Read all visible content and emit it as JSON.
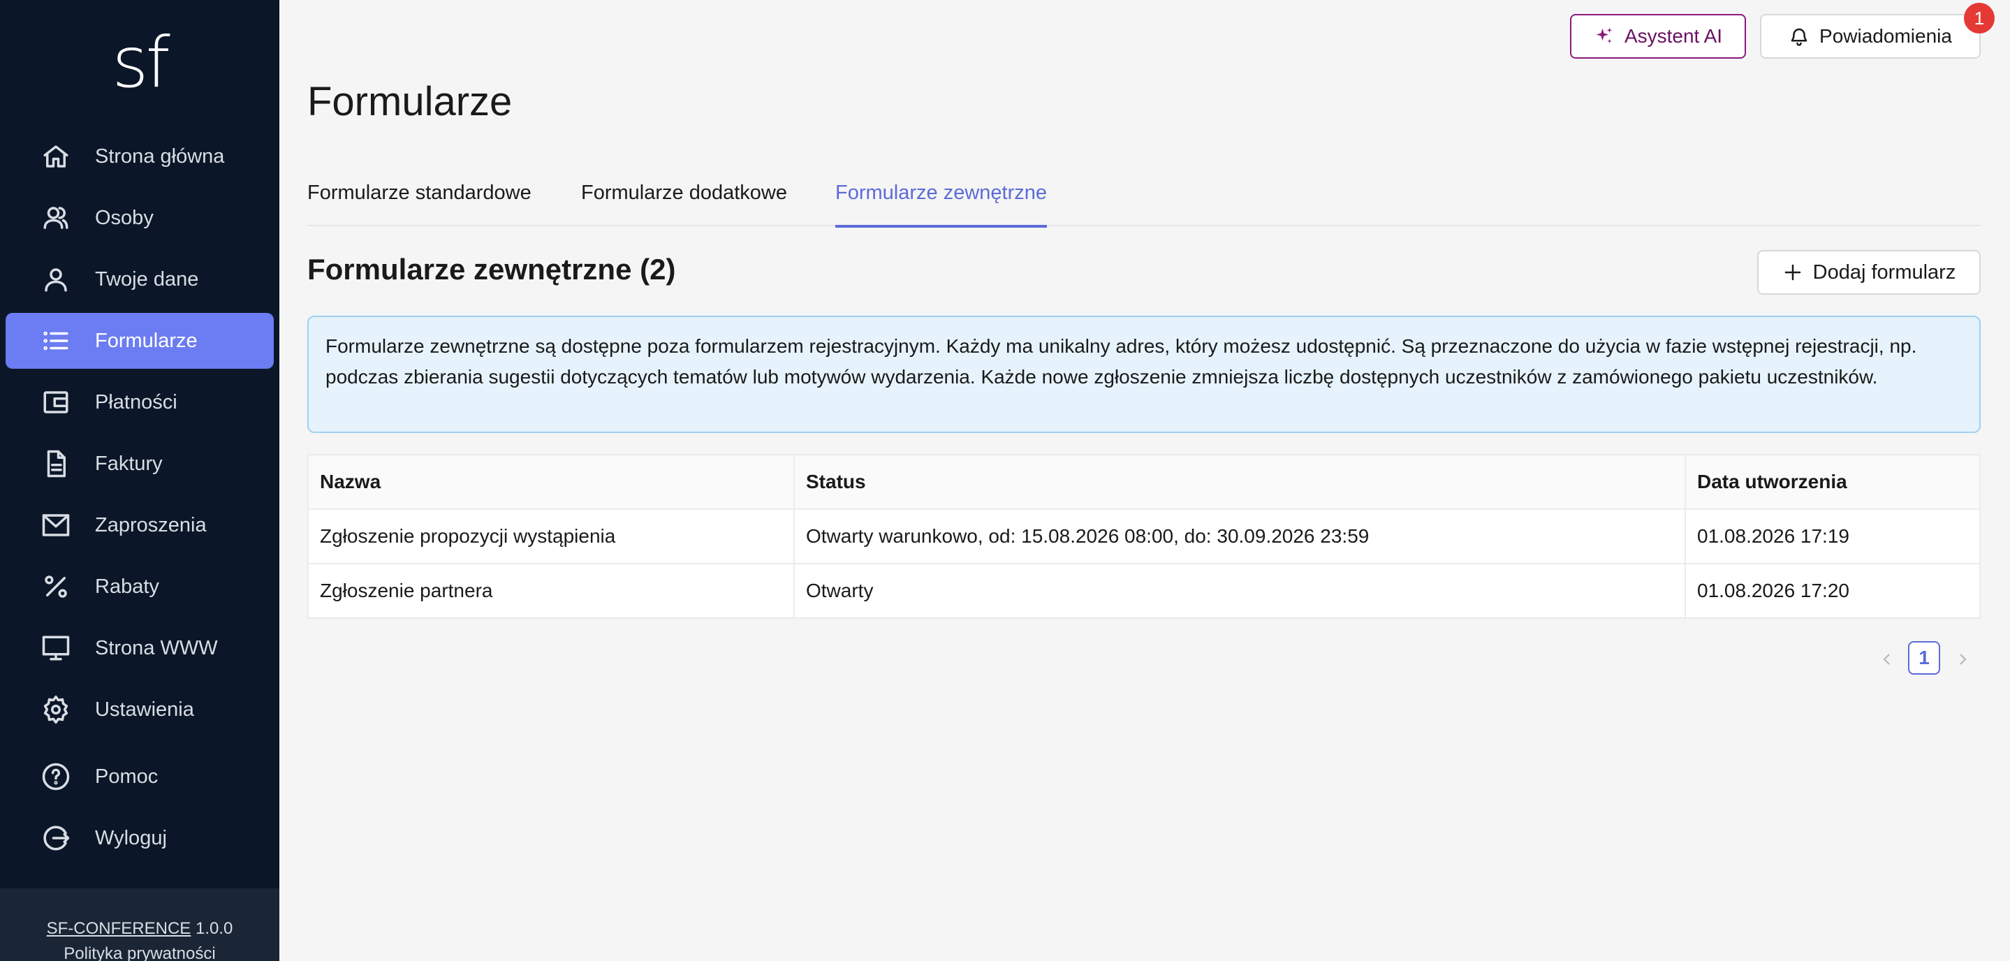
{
  "sidebar": {
    "logo": "sf",
    "items": [
      {
        "label": "Strona główna",
        "icon": "home-icon"
      },
      {
        "label": "Osoby",
        "icon": "people-icon"
      },
      {
        "label": "Twoje dane",
        "icon": "user-icon"
      },
      {
        "label": "Formularze",
        "icon": "list-icon",
        "active": true
      },
      {
        "label": "Płatności",
        "icon": "wallet-icon"
      },
      {
        "label": "Faktury",
        "icon": "document-icon"
      },
      {
        "label": "Zaproszenia",
        "icon": "mail-icon"
      },
      {
        "label": "Rabaty",
        "icon": "percent-icon"
      },
      {
        "label": "Strona WWW",
        "icon": "monitor-icon"
      },
      {
        "label": "Ustawienia",
        "icon": "gear-icon"
      },
      {
        "label": "Pomoc",
        "icon": "help-icon"
      },
      {
        "label": "Wyloguj",
        "icon": "logout-icon"
      }
    ],
    "footer": {
      "product": "SF-CONFERENCE",
      "version": "1.0.0",
      "privacy": "Polityka prywatności"
    }
  },
  "header": {
    "ai_button": "Asystent AI",
    "notifications_button": "Powiadomienia",
    "notifications_count": "1"
  },
  "page": {
    "title": "Formularze",
    "tabs": [
      {
        "label": "Formularze standardowe",
        "active": false
      },
      {
        "label": "Formularze dodatkowe",
        "active": false
      },
      {
        "label": "Formularze zewnętrzne",
        "active": true
      }
    ],
    "section_title": "Formularze zewnętrzne (2)",
    "add_button": "Dodaj formularz",
    "info": "Formularze zewnętrzne są dostępne poza formularzem rejestracyjnym. Każdy ma unikalny adres, który możesz udostępnić. Są przeznaczone do użycia w fazie wstępnej rejestracji, np. podczas zbierania sugestii dotyczących tematów lub motywów wydarzenia. Każde nowe zgłoszenie zmniejsza liczbę dostępnych uczestników z zamówionego pakietu uczestników."
  },
  "table": {
    "headers": [
      "Nazwa",
      "Status",
      "Data utworzenia"
    ],
    "rows": [
      [
        "Zgłoszenie propozycji wystąpienia",
        "Otwarty warunkowo, od: 15.08.2026 08:00, do: 30.09.2026 23:59",
        "01.08.2026 17:19"
      ],
      [
        "Zgłoszenie partnera",
        "Otwarty",
        "01.08.2026 17:20"
      ]
    ]
  },
  "pagination": {
    "current": "1"
  },
  "colors": {
    "sidebar_bg": "#0b1728",
    "active_nav": "#6c7cf2",
    "accent": "#5c6bd8",
    "ai_accent": "#8a1a7a",
    "badge": "#e53935",
    "info_bg": "#e6f3fc"
  }
}
